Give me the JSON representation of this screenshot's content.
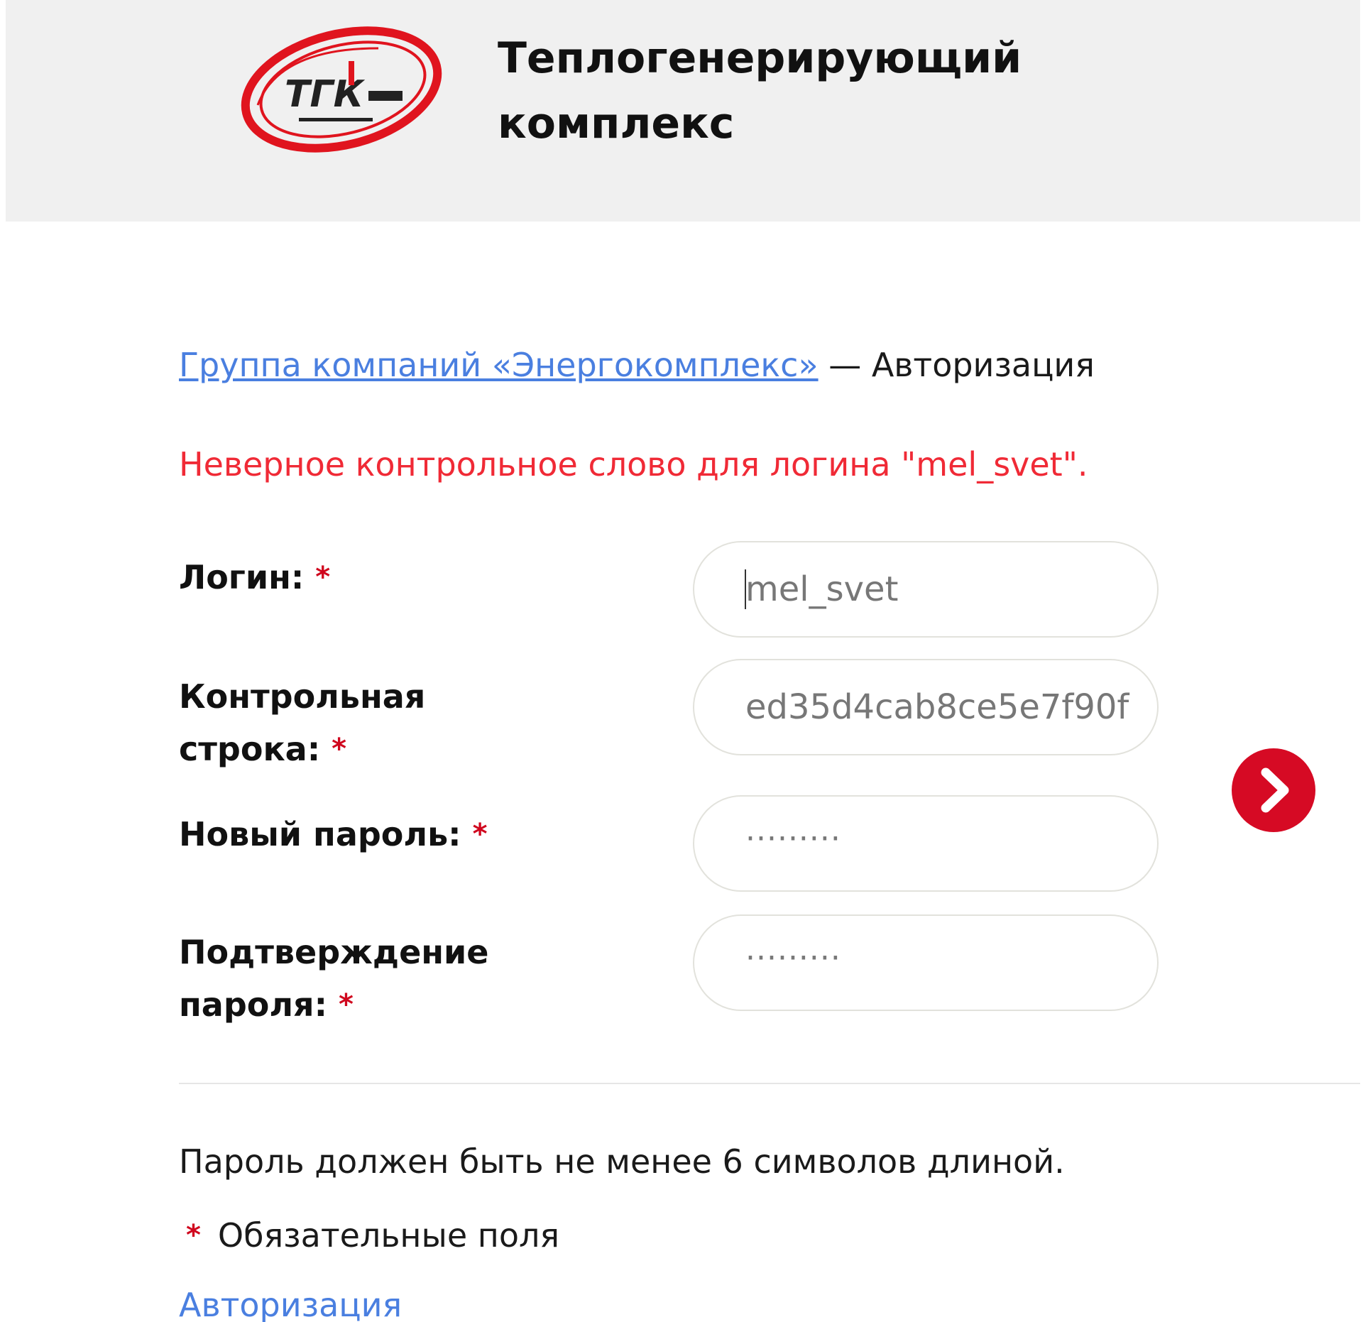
{
  "header": {
    "logo_icon": "tgk-logo-icon",
    "logo_text": "ТГК",
    "title": "Теплогенерирующий\nкомплекс"
  },
  "breadcrumb": {
    "link": "Группа компаний «Энергокомплекс»",
    "separator": " — ",
    "current": "Авторизация"
  },
  "error_message": "Неверное контрольное слово для логина \"mel_svet\".",
  "form": {
    "login": {
      "label": "Логин:",
      "value": "mel_svet"
    },
    "checkword": {
      "label": "Контрольная\nстрока:",
      "value": "ed35d4cab8ce5e7f90f"
    },
    "new_password": {
      "label": "Новый пароль:",
      "value": "·········"
    },
    "confirm_password": {
      "label": "Подтверждение\nпароля:",
      "value": "·········"
    },
    "required_mark": "*",
    "submit_icon": "chevron-right-icon"
  },
  "password_note": "Пароль должен быть не менее 6 символов длиной.",
  "required_note": "Обязательные поля",
  "auth_link": "Авторизация",
  "colors": {
    "header_bg": "#f0f0f0",
    "accent_red": "#d60a24",
    "error_red": "#f02a36",
    "link_blue": "#4a7fe0"
  }
}
